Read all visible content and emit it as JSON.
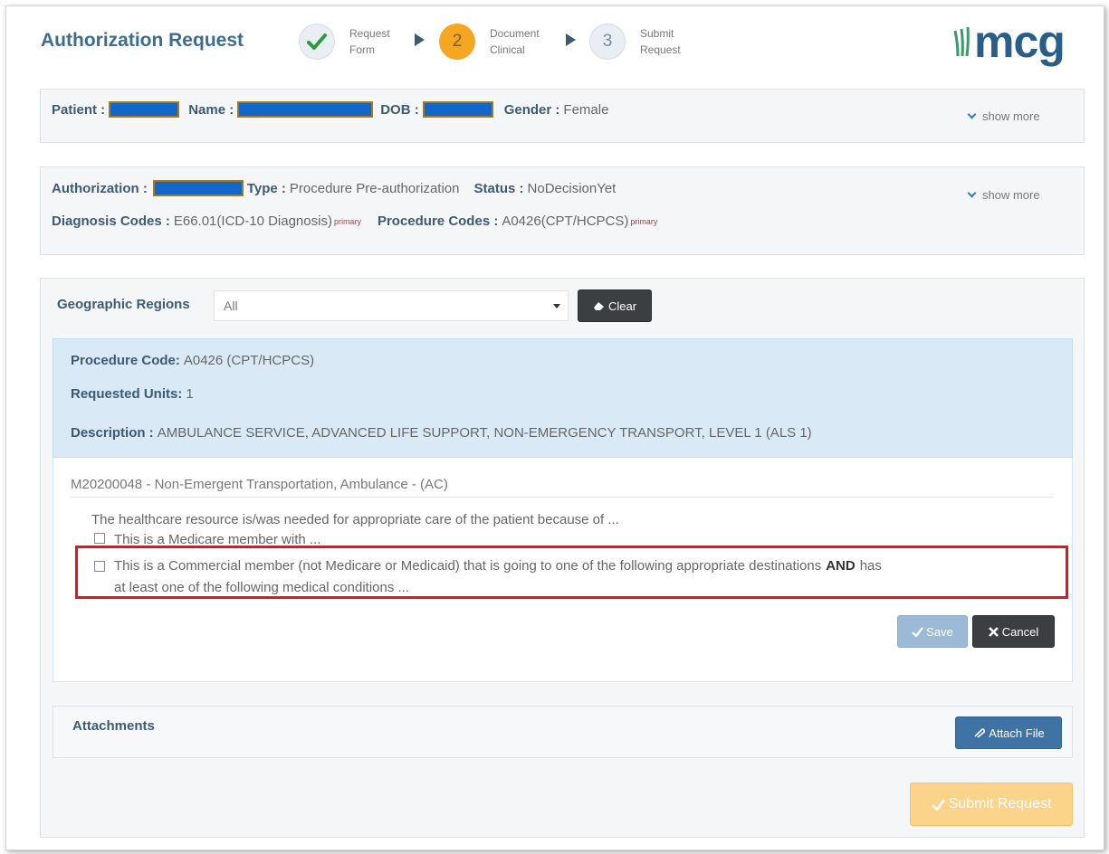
{
  "header": {
    "title": "Authorization Request",
    "steps": [
      {
        "number": "",
        "line1": "Request",
        "line2": "Form",
        "state": "done"
      },
      {
        "number": "2",
        "line1": "Document",
        "line2": "Clinical",
        "state": "active"
      },
      {
        "number": "3",
        "line1": "Submit",
        "line2": "Request",
        "state": "todo"
      }
    ],
    "logo_text": "mcg"
  },
  "patient": {
    "patient_label": "Patient :",
    "name_label": "Name :",
    "dob_label": "DOB :",
    "gender_label": "Gender :",
    "gender_value": "Female",
    "show_more": "show more"
  },
  "authorization": {
    "auth_label": "Authorization :",
    "type_label": "Type :",
    "type_value": "Procedure Pre-authorization",
    "status_label": "Status :",
    "status_value": "NoDecisionYet",
    "diag_label": "Diagnosis Codes :",
    "diag_value": "E66.01(ICD-10 Diagnosis)",
    "diag_tag": "primary",
    "proc_label": "Procedure Codes :",
    "proc_value": "A0426(CPT/HCPCS)",
    "proc_tag": "primary",
    "show_more": "show more"
  },
  "regions": {
    "label": "Geographic Regions",
    "selected": "All",
    "clear_label": "Clear"
  },
  "procedure": {
    "code_label": "Procedure Code:",
    "code_value": "A0426 (CPT/HCPCS)",
    "units_label": "Requested Units:",
    "units_value": "1",
    "desc_label": "Description :",
    "desc_value": "AMBULANCE SERVICE, ADVANCED LIFE SUPPORT, NON-EMERGENCY TRANSPORT, LEVEL 1 (ALS 1)"
  },
  "guideline": {
    "title": "M20200048 - Non-Emergent Transportation, Ambulance - (AC)",
    "intro": "The healthcare resource is/was needed for appropriate care of the patient because of ...",
    "option1": "This is a Medicare member with ...",
    "option2_part1": "This is a Commercial member (not Medicare or Medicaid) that is going to one of the following appropriate destinations",
    "option2_bold": "AND",
    "option2_part2": "has",
    "option2_line2": "at least one of the following medical conditions ...",
    "save_label": "Save",
    "cancel_label": "Cancel"
  },
  "attachments": {
    "label": "Attachments",
    "attach_label": "Attach File"
  },
  "footer": {
    "submit_label": "Submit Request"
  }
}
